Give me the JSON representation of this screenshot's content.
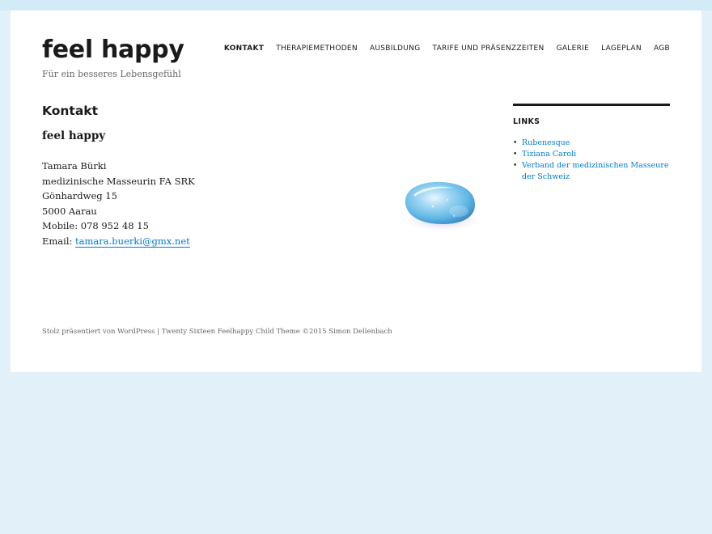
{
  "site": {
    "title": "feel happy",
    "tagline": "Für ein besseres Lebensgefühl"
  },
  "nav": {
    "items": [
      {
        "label": "Kontakt",
        "active": true
      },
      {
        "label": "Therapiemethoden",
        "active": false
      },
      {
        "label": "Ausbildung",
        "active": false
      },
      {
        "label": "Tarife und Präsenzzeiten",
        "active": false
      },
      {
        "label": "Galerie",
        "active": false
      },
      {
        "label": "Lageplan",
        "active": false
      },
      {
        "label": "AGB",
        "active": false
      }
    ]
  },
  "main": {
    "title": "Kontakt",
    "subheading": "feel happy",
    "address": {
      "name": "Tamara Bürki",
      "profession": "medizinische Masseurin FA SRK",
      "street": "Gönhardweg 15",
      "city": "5000 Aarau",
      "mobile": "Mobile: 078 952 48 15",
      "email_label": "Email: ",
      "email": "tamara.buerki@gmx.net"
    },
    "image_icon": "blue-glass-pebble"
  },
  "sidebar": {
    "widget_title": "Links",
    "links": [
      "Rubenesque",
      "Tiziana Caroli",
      "Verband der medizinischen Masseure der Schweiz"
    ]
  },
  "footer": {
    "text": "Stolz präsentiert von WordPress | Twenty Sixteen Feelhappy Child Theme ©2015 Simon Dellenbach"
  },
  "colors": {
    "background": "#e2f1f9",
    "link": "#007acc",
    "text": "#1a1a1a"
  }
}
